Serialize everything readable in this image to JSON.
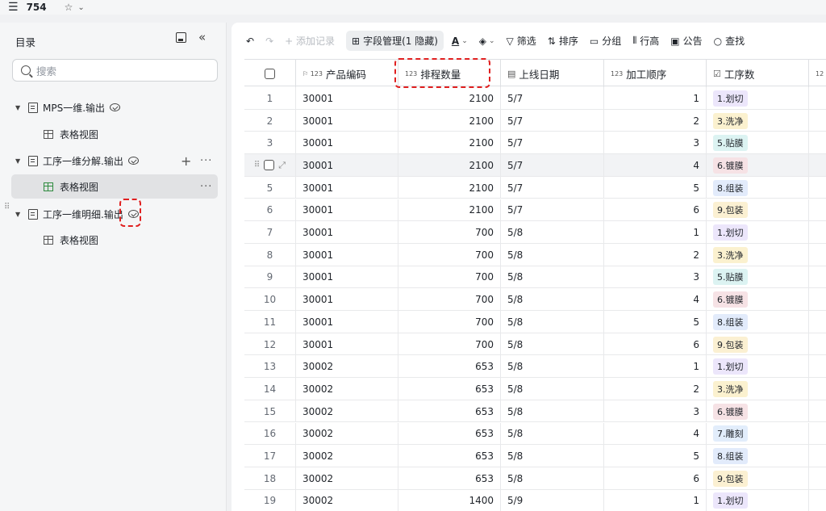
{
  "topbar": {
    "menu_icon": "☰",
    "title": "754",
    "star_icon": "☆",
    "chevron": "⌄"
  },
  "sidebar": {
    "heading": "目录",
    "search_placeholder": "搜索",
    "items": [
      {
        "label": "MPS一维.输出",
        "type": "table"
      },
      {
        "label": "表格视图",
        "type": "view"
      },
      {
        "label": "工序一维分解.输出",
        "type": "table"
      },
      {
        "label": "表格视图",
        "type": "view",
        "active": true
      },
      {
        "label": "工序一维明细.输出",
        "type": "table"
      },
      {
        "label": "表格视图",
        "type": "view"
      }
    ],
    "plus": "+",
    "more": "···"
  },
  "toolbar": {
    "undo": "↶",
    "redo": "↷",
    "add_record": "+ 添加记录",
    "field_manage": "字段管理(1 隐藏)",
    "font_color": "A",
    "fill_color": "◈",
    "filter": "筛选",
    "sort": "排序",
    "group": "分组",
    "row_height": "行高",
    "notice": "公告",
    "find": "查找"
  },
  "table": {
    "columns": [
      "产品编码",
      "排程数量",
      "上线日期",
      "加工顺序",
      "工序数",
      "12"
    ],
    "rows": [
      [
        "1",
        "30001",
        "2100",
        "5/7",
        "1",
        "1.划切"
      ],
      [
        "2",
        "30001",
        "2100",
        "5/7",
        "2",
        "3.洗净"
      ],
      [
        "3",
        "30001",
        "2100",
        "5/7",
        "3",
        "5.贴膜"
      ],
      [
        "4",
        "30001",
        "2100",
        "5/7",
        "4",
        "6.镀膜"
      ],
      [
        "5",
        "30001",
        "2100",
        "5/7",
        "5",
        "8.组装"
      ],
      [
        "6",
        "30001",
        "2100",
        "5/7",
        "6",
        "9.包装"
      ],
      [
        "7",
        "30001",
        "700",
        "5/8",
        "1",
        "1.划切"
      ],
      [
        "8",
        "30001",
        "700",
        "5/8",
        "2",
        "3.洗净"
      ],
      [
        "9",
        "30001",
        "700",
        "5/8",
        "3",
        "5.贴膜"
      ],
      [
        "10",
        "30001",
        "700",
        "5/8",
        "4",
        "6.镀膜"
      ],
      [
        "11",
        "30001",
        "700",
        "5/8",
        "5",
        "8.组装"
      ],
      [
        "12",
        "30001",
        "700",
        "5/8",
        "6",
        "9.包装"
      ],
      [
        "13",
        "30002",
        "653",
        "5/8",
        "1",
        "1.划切"
      ],
      [
        "14",
        "30002",
        "653",
        "5/8",
        "2",
        "3.洗净"
      ],
      [
        "15",
        "30002",
        "653",
        "5/8",
        "3",
        "6.镀膜"
      ],
      [
        "16",
        "30002",
        "653",
        "5/8",
        "4",
        "7.雕刻"
      ],
      [
        "17",
        "30002",
        "653",
        "5/8",
        "5",
        "8.组装"
      ],
      [
        "18",
        "30002",
        "653",
        "5/8",
        "6",
        "9.包装"
      ],
      [
        "19",
        "30002",
        "1400",
        "5/9",
        "1",
        "1.划切"
      ]
    ],
    "tag_colors": {
      "1.划切": "#ece6fb",
      "3.洗净": "#fbf1cf",
      "5.贴膜": "#dcf3f2",
      "6.镀膜": "#f6e2e5",
      "7.雕刻": "#e2edfb",
      "8.组装": "#e2ebfb",
      "9.包装": "#fbf0d2"
    },
    "column_type_icons": [
      "flag-num",
      "num",
      "calendar",
      "num",
      "select",
      "num"
    ]
  }
}
